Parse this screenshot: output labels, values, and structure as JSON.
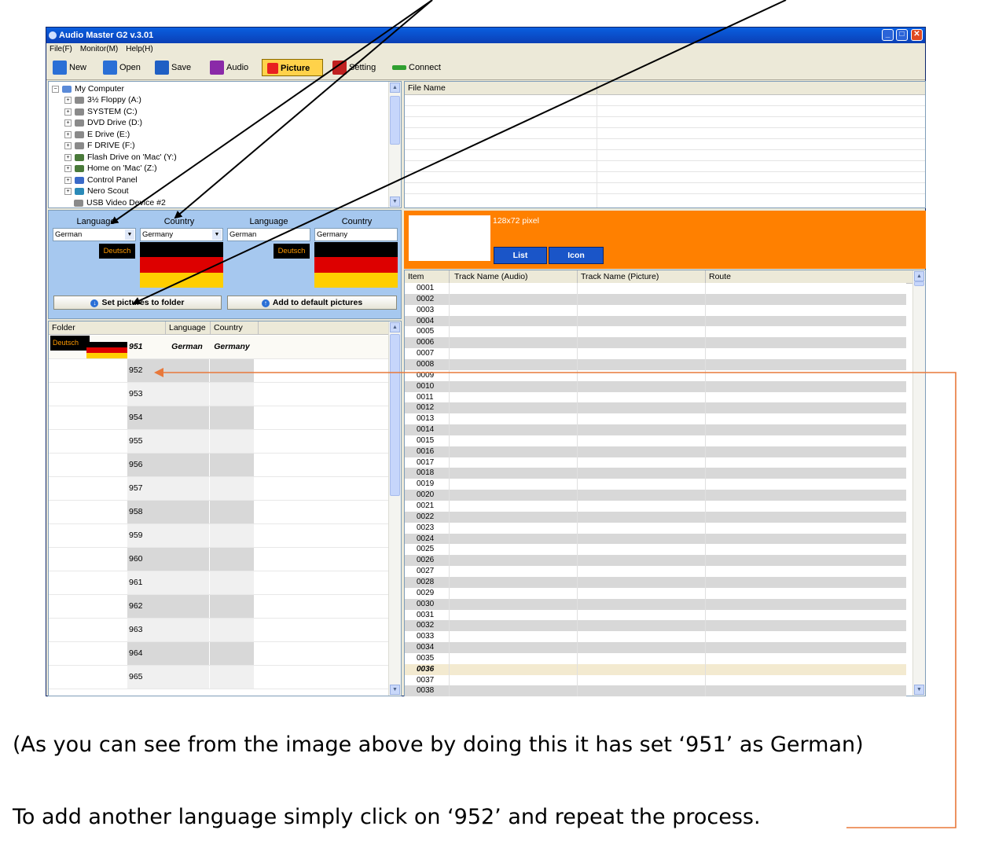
{
  "window": {
    "title": "Audio Master G2 v.3.01"
  },
  "menu": [
    "File(F)",
    "Monitor(M)",
    "Help(H)"
  ],
  "toolbar": {
    "new": "New",
    "open": "Open",
    "save": "Save",
    "audio": "Audio",
    "picture": "Picture",
    "setting": "Setting",
    "connect": "Connect"
  },
  "tree": [
    {
      "label": "My Computer",
      "icon": "computer-icon"
    },
    {
      "label": "3½ Floppy (A:)",
      "icon": "floppy-icon"
    },
    {
      "label": "SYSTEM (C:)",
      "icon": "drive-icon"
    },
    {
      "label": "DVD Drive (D:)",
      "icon": "dvd-icon"
    },
    {
      "label": "E Drive (E:)",
      "icon": "drive-icon"
    },
    {
      "label": "F DRIVE (F:)",
      "icon": "drive-icon"
    },
    {
      "label": "Flash Drive on 'Mac' (Y:)",
      "icon": "network-drive-icon"
    },
    {
      "label": "Home on 'Mac' (Z:)",
      "icon": "network-drive-icon"
    },
    {
      "label": "Control Panel",
      "icon": "control-panel-icon"
    },
    {
      "label": "Nero Scout",
      "icon": "nero-icon"
    },
    {
      "label": "USB Video Device #2",
      "icon": "camera-icon"
    }
  ],
  "file_list": {
    "header": "File Name"
  },
  "lang_panel": {
    "language_label": "Language",
    "country_label": "Country",
    "left_language": "German",
    "left_country": "Germany",
    "right_language": "German",
    "right_country": "Germany",
    "deutsch": "Deutsch",
    "set_button": "Set pictures to folder",
    "add_button": "Add to default pictures"
  },
  "folder_table": {
    "headers": [
      "Folder",
      "Language",
      "Country"
    ],
    "first_row": {
      "badge": "Deutsch",
      "number": "951",
      "language": "German",
      "country": "Germany"
    },
    "numbers": [
      "952",
      "953",
      "954",
      "955",
      "956",
      "957",
      "958",
      "959",
      "960",
      "961",
      "962",
      "963",
      "964",
      "965"
    ]
  },
  "preview": {
    "size_label": "128x72 pixel",
    "list_button": "List",
    "icon_button": "Icon"
  },
  "track_table": {
    "headers": [
      "Item",
      "Track Name (Audio)",
      "Track Name (Picture)",
      "Route"
    ],
    "items": [
      "0001",
      "0002",
      "0003",
      "0004",
      "0005",
      "0006",
      "0007",
      "0008",
      "0009",
      "0010",
      "0011",
      "0012",
      "0013",
      "0014",
      "0015",
      "0016",
      "0017",
      "0018",
      "0019",
      "0020",
      "0021",
      "0022",
      "0023",
      "0024",
      "0025",
      "0026",
      "0027",
      "0028",
      "0029",
      "0030",
      "0031",
      "0032",
      "0033",
      "0034",
      "0035",
      "0036",
      "0037",
      "0038"
    ],
    "highlight_item": "0036"
  },
  "captions": {
    "line1": "(As you can see from the image above by doing this it has set ‘951’ as German)",
    "line2": "To add another language simply click on ‘952’ and repeat the process."
  },
  "colors": {
    "flag_black": "#000000",
    "flag_red": "#dd0000",
    "flag_gold": "#ffce00",
    "preview_bg": "#ff8000",
    "arrow_orange": "#e8783a"
  }
}
